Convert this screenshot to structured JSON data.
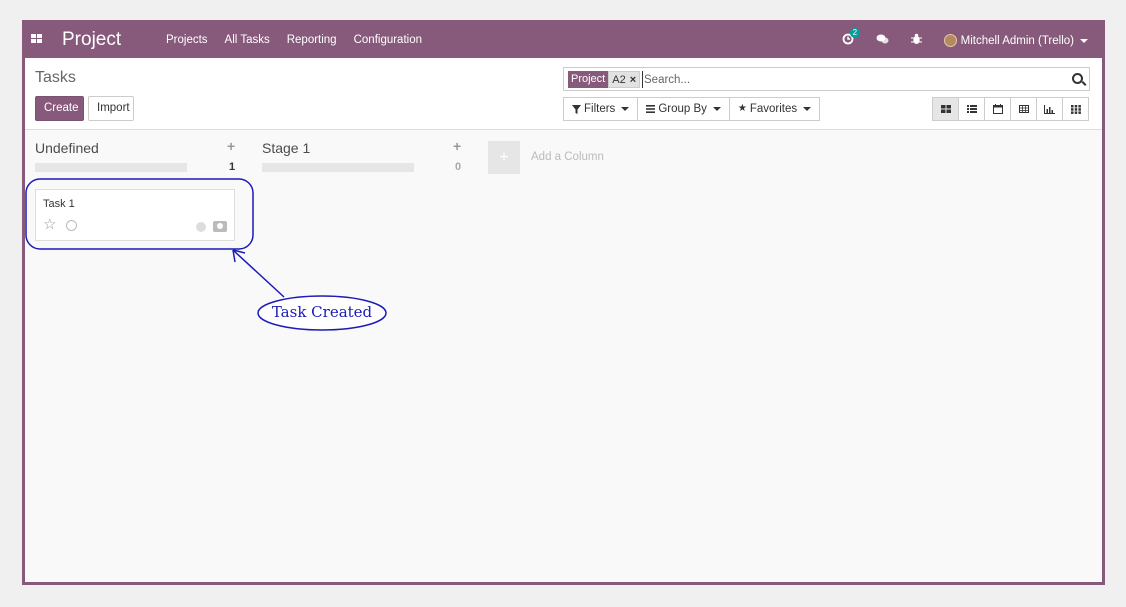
{
  "navbar": {
    "brand": "Project",
    "menu": [
      "Projects",
      "All Tasks",
      "Reporting",
      "Configuration"
    ],
    "activity_count": "2",
    "user_name": "Mitchell Admin (Trello)"
  },
  "control": {
    "title": "Tasks",
    "create_label": "Create",
    "import_label": "Import",
    "search": {
      "facet_label": "Project",
      "facet_value": "A2",
      "facet_remove": "×",
      "placeholder": "Search..."
    },
    "filters_label": "Filters",
    "groupby_label": "Group By",
    "favorites_label": "Favorites",
    "views": [
      "kanban-icon",
      "list-icon",
      "calendar-icon",
      "pivot-icon",
      "graph-icon",
      "activity-icon"
    ]
  },
  "kanban": {
    "columns": [
      {
        "title": "Undefined",
        "count": "1",
        "add": "+"
      },
      {
        "title": "Stage 1",
        "count": "0",
        "add": "+"
      }
    ],
    "add_column_icon": "+",
    "add_column_label": "Add a Column",
    "cards": [
      {
        "title": "Task 1",
        "star": "☆"
      }
    ]
  },
  "annotation": {
    "text": "Task  Created",
    "color": "#1b1bb8"
  },
  "colors": {
    "brand": "#875a7b",
    "badge": "#00a09d"
  }
}
